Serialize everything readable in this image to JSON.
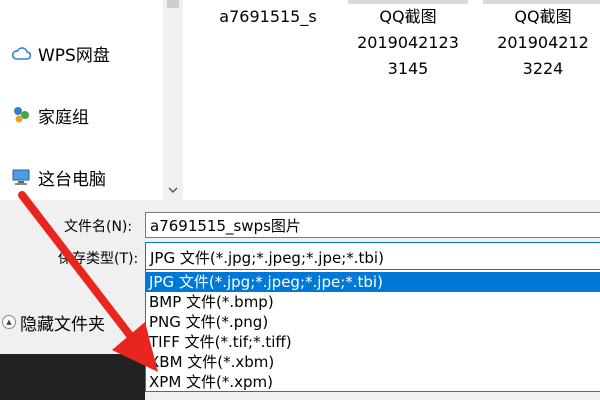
{
  "nav": {
    "items": [
      {
        "label": "WPS网盘",
        "icon": "cloud-icon"
      },
      {
        "label": "家庭组",
        "icon": "homegroup-icon"
      },
      {
        "label": "这台电脑",
        "icon": "computer-icon"
      }
    ]
  },
  "files": [
    {
      "lines": [
        "a7691515_s"
      ]
    },
    {
      "lines": [
        "QQ截图",
        "2019042123",
        "3145"
      ]
    },
    {
      "lines": [
        "QQ截图",
        "201904212",
        "3224"
      ]
    }
  ],
  "form": {
    "filename_label": "文件名(N):",
    "filename_value": "a7691515_swps图片",
    "filetype_label": "保存类型(T):",
    "filetype_value": "JPG 文件(*.jpg;*.jpeg;*.jpe;*.tbi)",
    "options": [
      "JPG 文件(*.jpg;*.jpeg;*.jpe;*.tbi)",
      "BMP 文件(*.bmp)",
      "PNG 文件(*.png)",
      "TIFF 文件(*.tif;*.tiff)",
      "XBM 文件(*.xbm)",
      "XPM 文件(*.xpm)"
    ],
    "hide_folders_label": "隐藏文件夹"
  },
  "colors": {
    "selection": "#0078d7",
    "arrow": "#e8261f"
  }
}
